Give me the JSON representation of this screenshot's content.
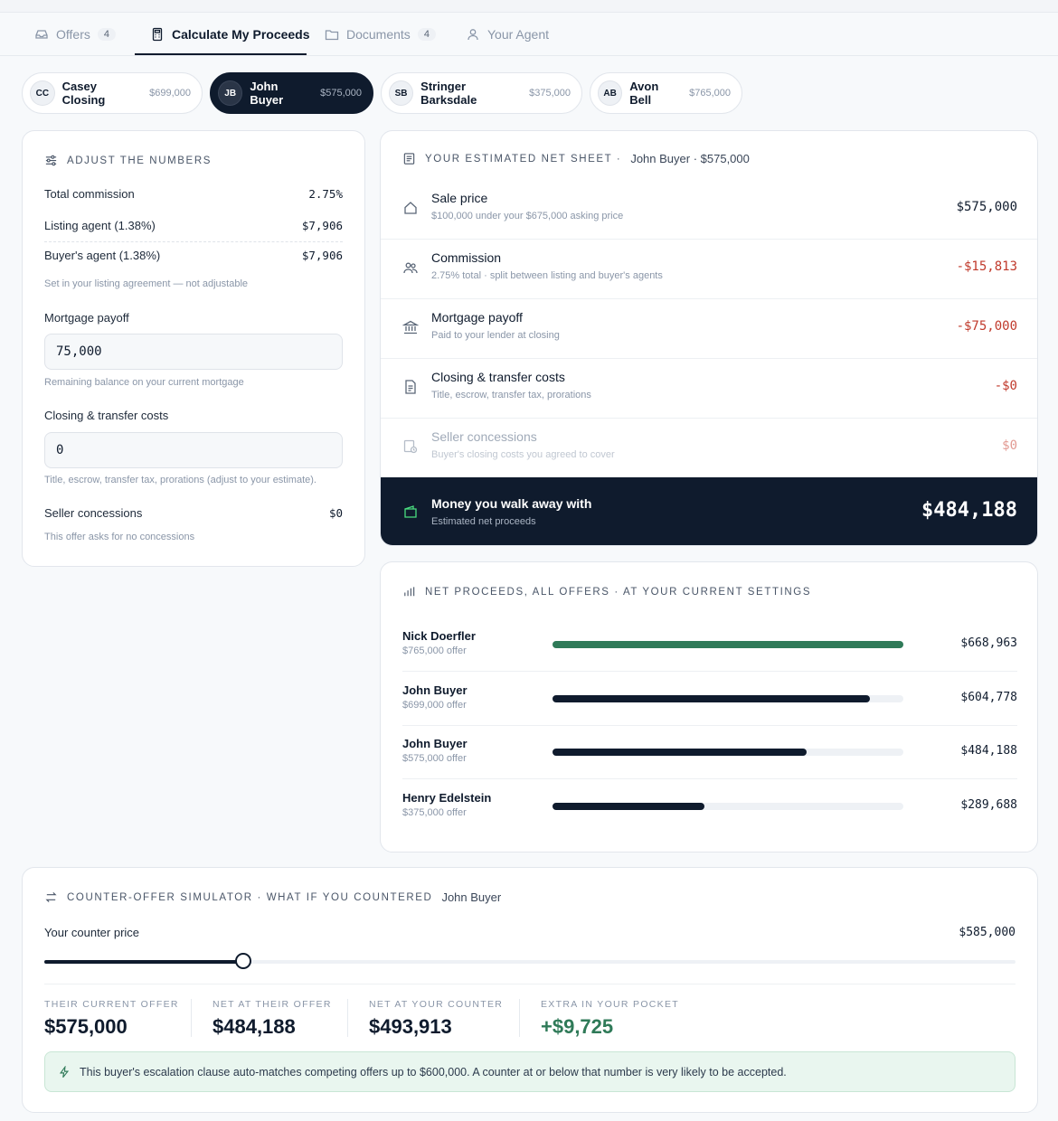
{
  "tabs": [
    {
      "label": "Offers",
      "count": "4"
    },
    {
      "label": "Calculate My Proceeds"
    },
    {
      "label": "Documents",
      "count": "4"
    },
    {
      "label": "Your Agent"
    }
  ],
  "offers": [
    {
      "initials": "CC",
      "name": "Casey Closing",
      "price": "$699,000"
    },
    {
      "initials": "JB",
      "name": "John Buyer",
      "price": "$575,000"
    },
    {
      "initials": "SB",
      "name": "Stringer Barksdale",
      "price": "$375,000"
    },
    {
      "initials": "AB",
      "name": "Avon Bell",
      "price": "$765,000"
    }
  ],
  "adjust": {
    "heading": "Adjust the numbers",
    "total_commission_label": "Total commission",
    "total_commission_value": "2.75%",
    "listing_agent_label": "Listing agent (1.38%)",
    "listing_agent_value": "$7,906",
    "buyers_agent_label": "Buyer's agent (1.38%)",
    "buyers_agent_value": "$7,906",
    "commission_hint": "Set in your listing agreement — not adjustable",
    "mortgage_label": "Mortgage payoff",
    "mortgage_value": "75,000",
    "mortgage_hint": "Remaining balance on your current mortgage",
    "closing_label": "Closing & transfer costs",
    "closing_value": "0",
    "closing_hint": "Title, escrow, transfer tax, prorations (adjust to your estimate).",
    "concessions_label": "Seller concessions",
    "concessions_value": "$0",
    "concessions_hint": "This offer asks for no concessions"
  },
  "net_sheet": {
    "heading": "Your estimated net sheet ·",
    "subject": "John Buyer · $575,000",
    "rows": [
      {
        "title": "Sale price",
        "sub": "$100,000 under your $675,000 asking price",
        "amount": "$575,000"
      },
      {
        "title": "Commission",
        "sub": "2.75% total · split between listing and buyer's agents",
        "amount": "-$15,813"
      },
      {
        "title": "Mortgage payoff",
        "sub": "Paid to your lender at closing",
        "amount": "-$75,000"
      },
      {
        "title": "Closing & transfer costs",
        "sub": "Title, escrow, transfer tax, prorations",
        "amount": "-$0"
      },
      {
        "title": "Seller concessions",
        "sub": "Buyer's closing costs you agreed to cover",
        "amount": "$0"
      }
    ],
    "walk_title": "Money you walk away with",
    "walk_sub": "Estimated net proceeds",
    "walk_amount": "$484,188"
  },
  "all_offers": {
    "heading": "Net proceeds, all offers · at your current settings",
    "max_value": 668963,
    "rows": [
      {
        "name": "Nick Doerfler",
        "offer": "$765,000 offer",
        "net": 668963,
        "net_label": "$668,963",
        "best": true
      },
      {
        "name": "John Buyer",
        "offer": "$699,000 offer",
        "net": 604778,
        "net_label": "$604,778",
        "best": false
      },
      {
        "name": "John Buyer",
        "offer": "$575,000 offer",
        "net": 484188,
        "net_label": "$484,188",
        "best": false
      },
      {
        "name": "Henry Edelstein",
        "offer": "$375,000 offer",
        "net": 289688,
        "net_label": "$289,688",
        "best": false
      }
    ]
  },
  "counter": {
    "heading": "Counter-offer simulator · what if you countered",
    "subject": "John Buyer",
    "price_label": "Your counter price",
    "price_value": "$585,000",
    "slider_fraction": 0.205,
    "stats": [
      {
        "label": "Their current offer",
        "value": "$575,000"
      },
      {
        "label": "Net at their offer",
        "value": "$484,188"
      },
      {
        "label": "Net at your counter",
        "value": "$493,913"
      },
      {
        "label": "Extra in your pocket",
        "value": "+$9,725"
      }
    ],
    "note": "This buyer's escalation clause auto-matches competing offers up to $600,000. A counter at or below that number is very likely to be accepted."
  },
  "colors": {
    "primary": "#0f1b2d",
    "positive": "#2f7a58",
    "negative": "#c0392b"
  }
}
